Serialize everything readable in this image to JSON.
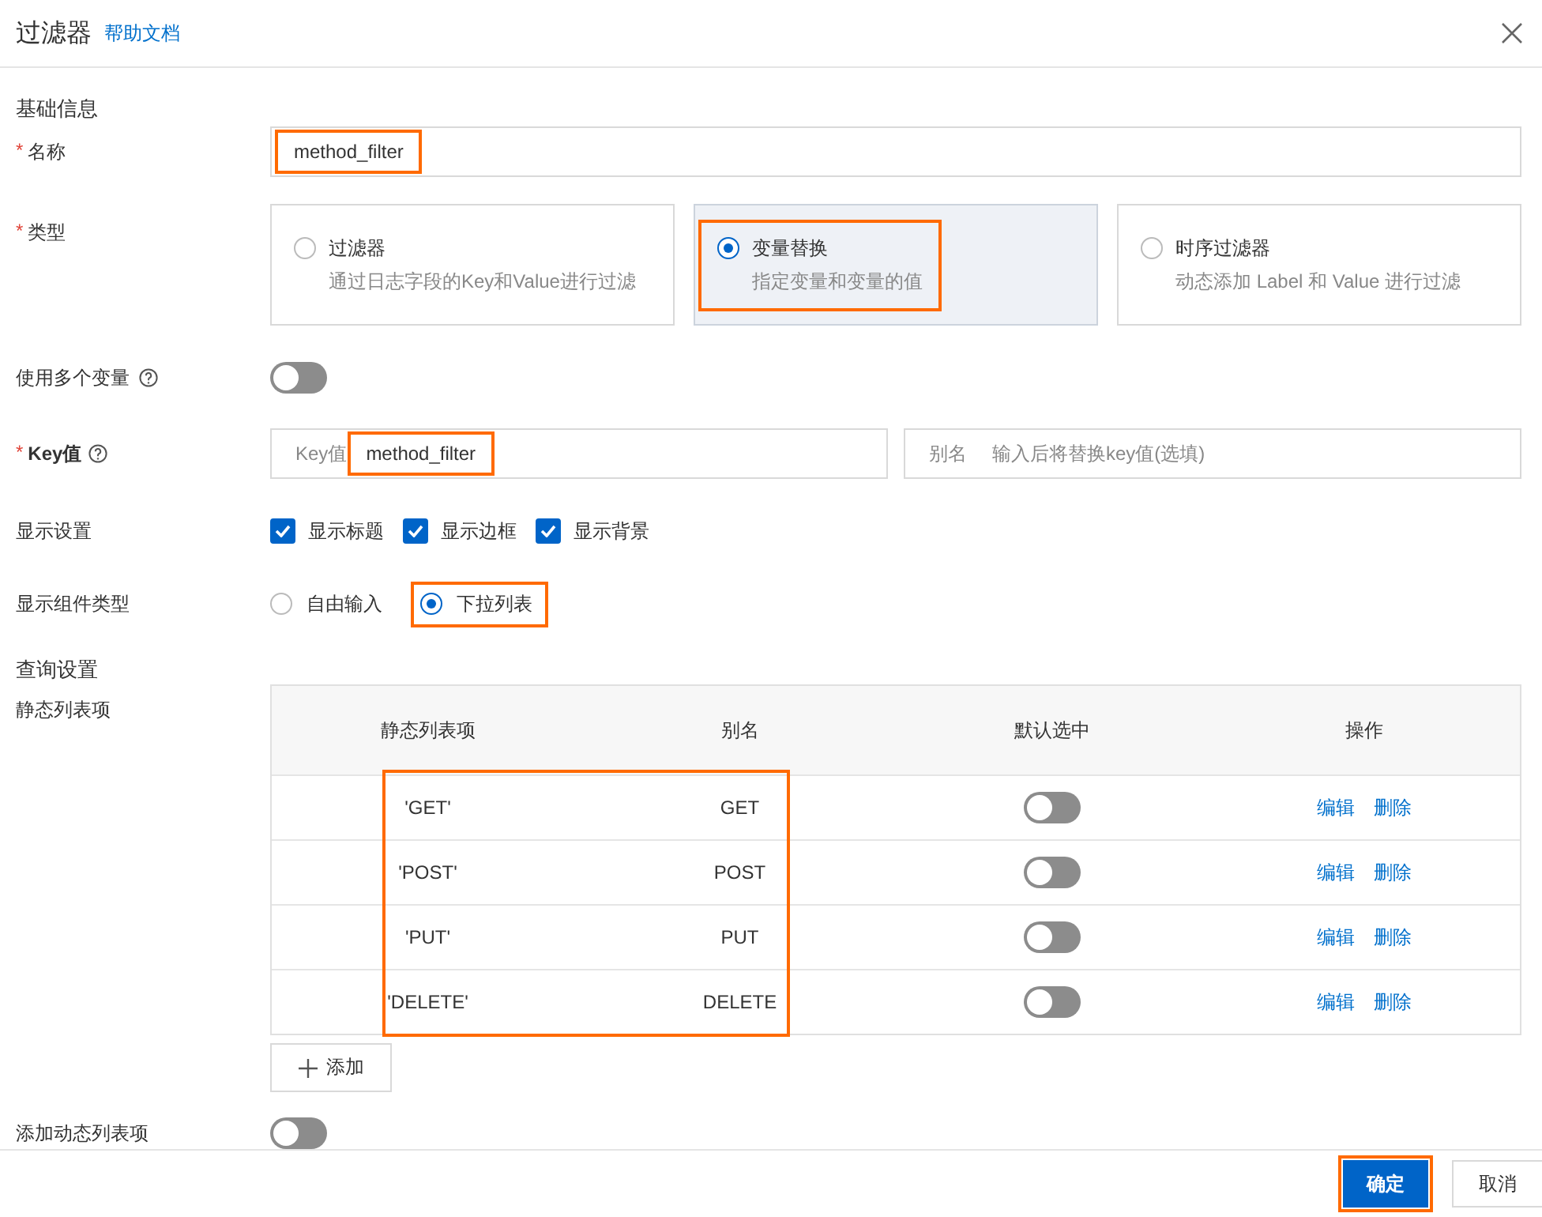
{
  "dialog": {
    "title": "过滤器",
    "help_link": "帮助文档"
  },
  "basic_heading": "基础信息",
  "name": {
    "label": "名称",
    "marker": "*",
    "value": "method_filter",
    "highlighted": true
  },
  "type": {
    "label": "类型",
    "marker": "*",
    "options": [
      {
        "title": "过滤器",
        "description": "通过日志字段的Key和Value进行过滤",
        "selected": false,
        "highlighted": false
      },
      {
        "title": "变量替换",
        "description": "指定变量和变量的值",
        "selected": true,
        "highlighted": true
      },
      {
        "title": "时序过滤器",
        "description": "动态添加 Label 和 Value 进行过滤",
        "selected": false,
        "highlighted": false
      }
    ]
  },
  "multi_variable": {
    "label": "使用多个变量",
    "on": false
  },
  "key": {
    "label": "Key值",
    "marker": "*",
    "prefix": "Key值",
    "value": "method_filter",
    "highlighted": true,
    "alias_prefix": "别名",
    "alias_placeholder": "输入后将替换key值(选填)"
  },
  "display": {
    "label": "显示设置",
    "options": [
      {
        "label": "显示标题",
        "checked": true
      },
      {
        "label": "显示边框",
        "checked": true
      },
      {
        "label": "显示背景",
        "checked": true
      }
    ]
  },
  "component_type": {
    "label": "显示组件类型",
    "options": [
      {
        "label": "自由输入",
        "selected": false,
        "highlighted": false
      },
      {
        "label": "下拉列表",
        "selected": true,
        "highlighted": true
      }
    ]
  },
  "query_heading": "查询设置",
  "static_list": {
    "label": "静态列表项",
    "highlighted": true,
    "columns": [
      "静态列表项",
      "别名",
      "默认选中",
      "操作"
    ],
    "rows": [
      {
        "value": "'GET'",
        "alias": "GET",
        "default_selected": false,
        "actions": [
          "编辑",
          "删除"
        ]
      },
      {
        "value": "'POST'",
        "alias": "POST",
        "default_selected": false,
        "actions": [
          "编辑",
          "删除"
        ]
      },
      {
        "value": "'PUT'",
        "alias": "PUT",
        "default_selected": false,
        "actions": [
          "编辑",
          "删除"
        ]
      },
      {
        "value": "'DELETE'",
        "alias": "DELETE",
        "default_selected": false,
        "actions": [
          "编辑",
          "删除"
        ]
      }
    ],
    "add_button": "添加"
  },
  "dynamic_list": {
    "label": "添加动态列表项",
    "on": false
  },
  "footer": {
    "buttons": [
      {
        "label": "确定",
        "kind": "primary",
        "highlighted": true
      },
      {
        "label": "取消",
        "kind": "default",
        "highlighted": false
      }
    ]
  }
}
